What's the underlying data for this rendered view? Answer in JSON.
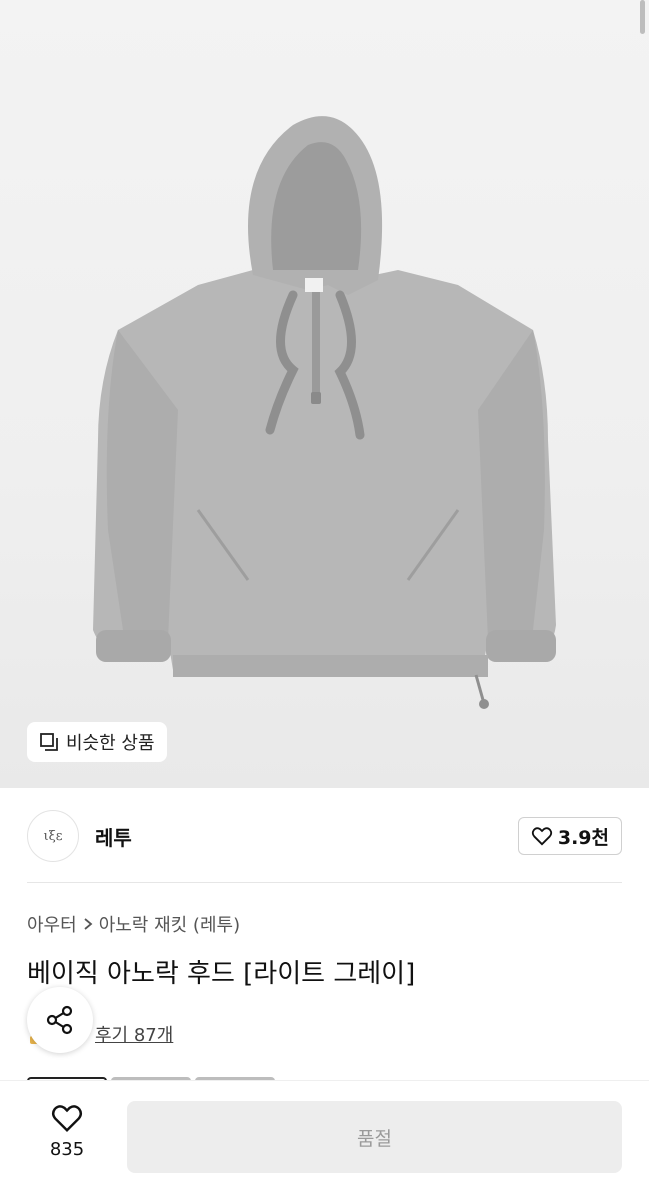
{
  "hero": {
    "similar_button": "비슷한 상품",
    "image_alt": "grey anorak hoodie"
  },
  "brand": {
    "logo_text": "ιξε",
    "name": "레투",
    "likes": "3.9천"
  },
  "breadcrumb": {
    "category": "아우터",
    "subcategory": "아노락 재킷 (레투)"
  },
  "product": {
    "title": "베이직 아노락 후드 [라이트 그레이]",
    "reviews": "후기 87개"
  },
  "bottom_bar": {
    "wish_count": "835",
    "status_button": "품절"
  },
  "icons": [
    "similar-icon",
    "heart-icon",
    "chevron-right-icon",
    "share-icon",
    "heart-icon"
  ],
  "colors": {
    "soldout_bg": "#ededed",
    "soldout_text": "#9a9a9a",
    "text": "#111111"
  }
}
